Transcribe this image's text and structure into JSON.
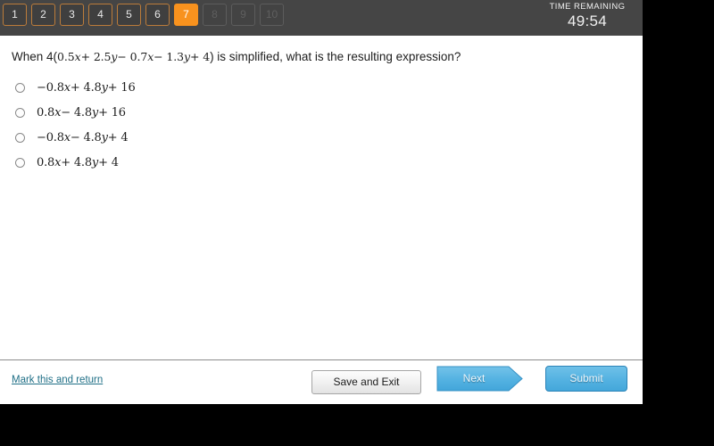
{
  "header": {
    "question_nav": [
      {
        "label": "1",
        "state": "visited"
      },
      {
        "label": "2",
        "state": "visited"
      },
      {
        "label": "3",
        "state": "visited"
      },
      {
        "label": "4",
        "state": "visited"
      },
      {
        "label": "5",
        "state": "visited"
      },
      {
        "label": "6",
        "state": "visited"
      },
      {
        "label": "7",
        "state": "active"
      },
      {
        "label": "8",
        "state": "disabled"
      },
      {
        "label": "9",
        "state": "disabled"
      },
      {
        "label": "10",
        "state": "disabled"
      }
    ],
    "timer_label": "TIME REMAINING",
    "timer_value": "49:54",
    "accent_color": "#f8921e",
    "bar_color": "#454545"
  },
  "question": {
    "prefix": "When 4(",
    "expression": "0.5x + 2.5y − 0.7x − 1.3y + 4",
    "suffix": ") is simplified, what is the resulting expression?",
    "expression_parts": {
      "p1": "0.5",
      "v1": "x",
      "op1": "+ 2.5",
      "v2": "y",
      "op2": "− 0.7",
      "v3": "x",
      "op3": "− 1.3",
      "v4": "y",
      "op4": "+ 4"
    }
  },
  "options": [
    {
      "id": "option-a",
      "text": "−0.8x + 4.8y + 16",
      "selected": false,
      "parts": {
        "a": "−0.8",
        "x": "x",
        "b": "+ 4.8",
        "y": "y",
        "c": "+ 16"
      }
    },
    {
      "id": "option-b",
      "text": "0.8x − 4.8y + 16",
      "selected": false,
      "parts": {
        "a": "0.8",
        "x": "x",
        "b": "− 4.8",
        "y": "y",
        "c": "+ 16"
      }
    },
    {
      "id": "option-c",
      "text": "−0.8x − 4.8y + 4",
      "selected": false,
      "parts": {
        "a": "−0.8",
        "x": "x",
        "b": "− 4.8",
        "y": "y",
        "c": "+ 4"
      }
    },
    {
      "id": "option-d",
      "text": "0.8x + 4.8y + 4",
      "selected": false,
      "parts": {
        "a": "0.8",
        "x": "x",
        "b": "+ 4.8",
        "y": "y",
        "c": "+ 4"
      }
    }
  ],
  "footer": {
    "mark_link": "Mark this and return",
    "save_label": "Save and Exit",
    "next_label": "Next",
    "submit_label": "Submit",
    "link_color": "#1f6f86",
    "primary_button_color": "#56b3e2"
  }
}
